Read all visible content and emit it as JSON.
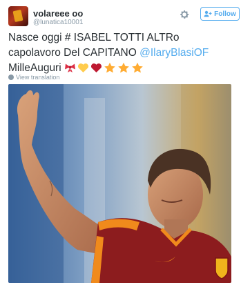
{
  "user": {
    "display_name": "volareee oo",
    "handle": "@lunatica10001"
  },
  "actions": {
    "follow_label": "Follow",
    "settings_icon": "gear-icon"
  },
  "tweet": {
    "line1": "Nasce oggi # ISABEL TOTTI ALTRo",
    "line2_text": "capolavoro Del CAPITANO ",
    "line2_mention": "@IlaryBlasiOF",
    "line3_text": "MilleAuguri",
    "emojis": [
      "ribbon-emoji",
      "yellow-heart-emoji",
      "red-heart-emoji",
      "star-emoji",
      "star-emoji",
      "star-emoji"
    ]
  },
  "translate": {
    "label": "View translation"
  },
  "media": {
    "description_icon": "photo",
    "colors": {
      "jersey": "#8c1c1e",
      "trim": "#f08a1c",
      "sky": "#9ab8d8"
    }
  }
}
